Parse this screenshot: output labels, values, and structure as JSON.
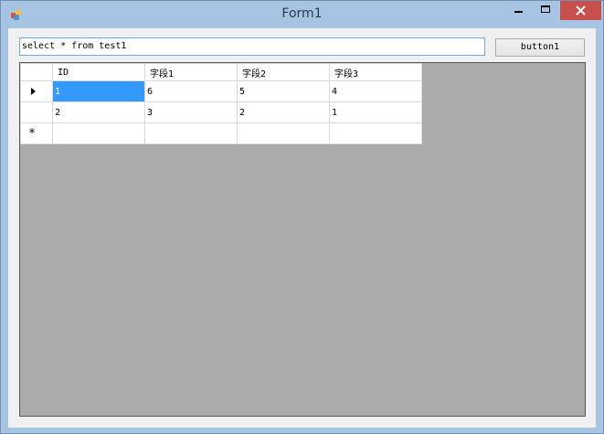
{
  "window": {
    "title": "Form1"
  },
  "query": {
    "value": "select * from test1"
  },
  "toolbar": {
    "run_label": "button1"
  },
  "grid": {
    "columns": [
      "ID",
      "字段1",
      "字段2",
      "字段3"
    ],
    "rows": [
      [
        "1",
        "6",
        "5",
        "4"
      ],
      [
        "2",
        "3",
        "2",
        "1"
      ],
      [
        "",
        "",
        "",
        ""
      ]
    ],
    "new_row_marker": "*"
  },
  "icons": {
    "app": "app-icon",
    "minimize": "minimize-icon",
    "maximize": "maximize-icon",
    "close": "close-icon",
    "current_row": "row-pointer-icon"
  },
  "colors": {
    "title_bar": "#a7c4e3",
    "close_button": "#c7504c",
    "selection": "#3399ff",
    "grid_background": "#ababab"
  }
}
